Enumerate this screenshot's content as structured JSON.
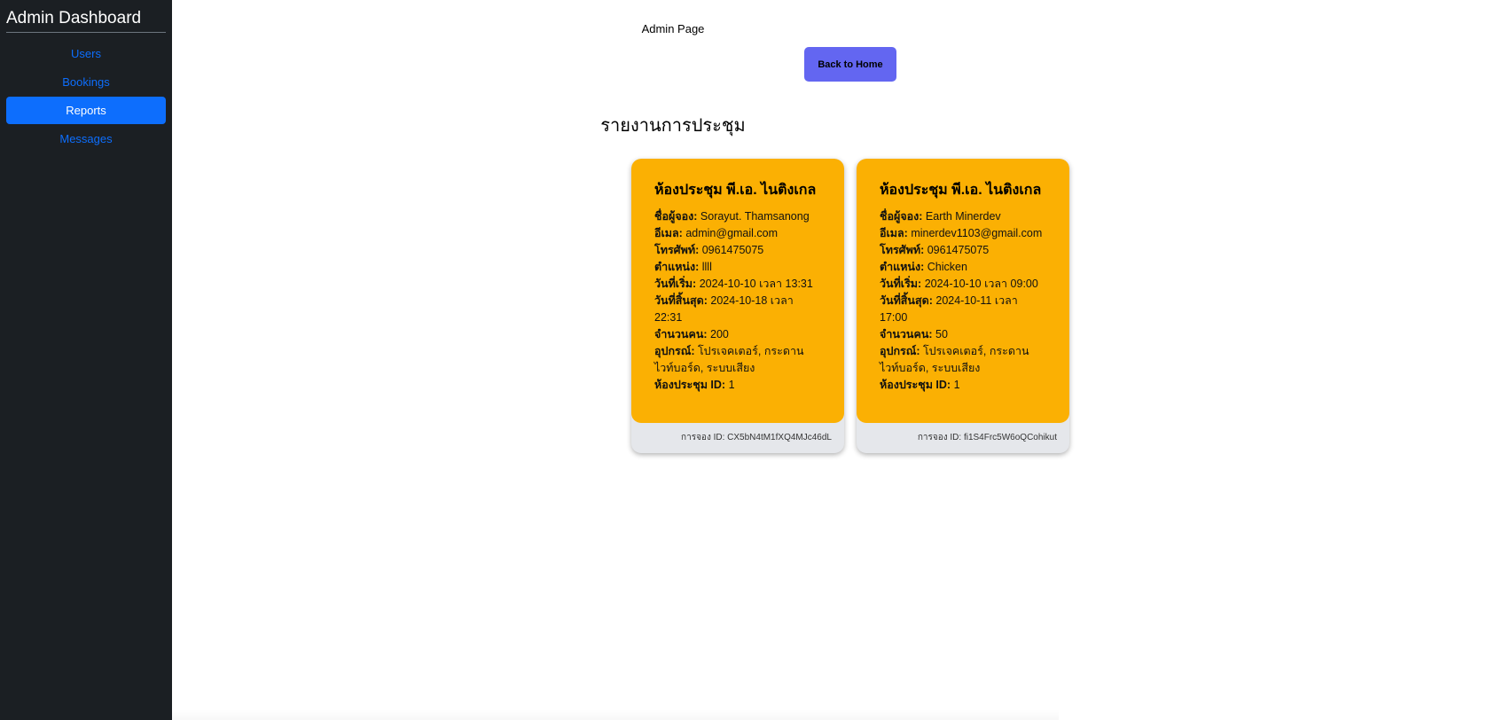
{
  "sidebar": {
    "brand": "Admin Dashboard",
    "items": [
      {
        "label": "Users"
      },
      {
        "label": "Bookings"
      },
      {
        "label": "Reports"
      },
      {
        "label": "Messages"
      }
    ]
  },
  "main": {
    "heading": "Admin Page",
    "back_button": "Back to Home",
    "section_title": "รายงานการประชุม"
  },
  "field_labels": {
    "booker": "ชื่อผู้จอง:",
    "email": "อีเมล:",
    "phone": "โทรศัพท์:",
    "position": "ตำแหน่ง:",
    "start": "วันที่เริ่ม:",
    "end": "วันที่สิ้นสุด:",
    "people": "จำนวนคน:",
    "equipment": "อุปกรณ์:",
    "room_id": "ห้องประชุม ID:"
  },
  "cards": [
    {
      "title": "ห้องประชุม พี.เอ. ไนติงเกล",
      "booker": "Sorayut. Thamsanong",
      "email": "admin@gmail.com",
      "phone": "0961475075",
      "position": "llll",
      "start": "2024-10-10 เวลา 13:31",
      "end": "2024-10-18 เวลา 22:31",
      "people": "200",
      "equipment": "โปรเจคเตอร์, กระดานไวท์บอร์ด, ระบบเสียง",
      "room_id": "1",
      "footer": "การจอง ID: CX5bN4tM1fXQ4MJc46dL"
    },
    {
      "title": "ห้องประชุม พี.เอ. ไนติงเกล",
      "booker": "Earth Minerdev",
      "email": "minerdev1103@gmail.com",
      "phone": "0961475075",
      "position": "Chicken",
      "start": "2024-10-10 เวลา 09:00",
      "end": "2024-10-11 เวลา 17:00",
      "people": "50",
      "equipment": "โปรเจคเตอร์, กระดานไวท์บอร์ด, ระบบเสียง",
      "room_id": "1",
      "footer": "การจอง ID: fi1S4Frc5W6oQCohikut"
    }
  ]
}
